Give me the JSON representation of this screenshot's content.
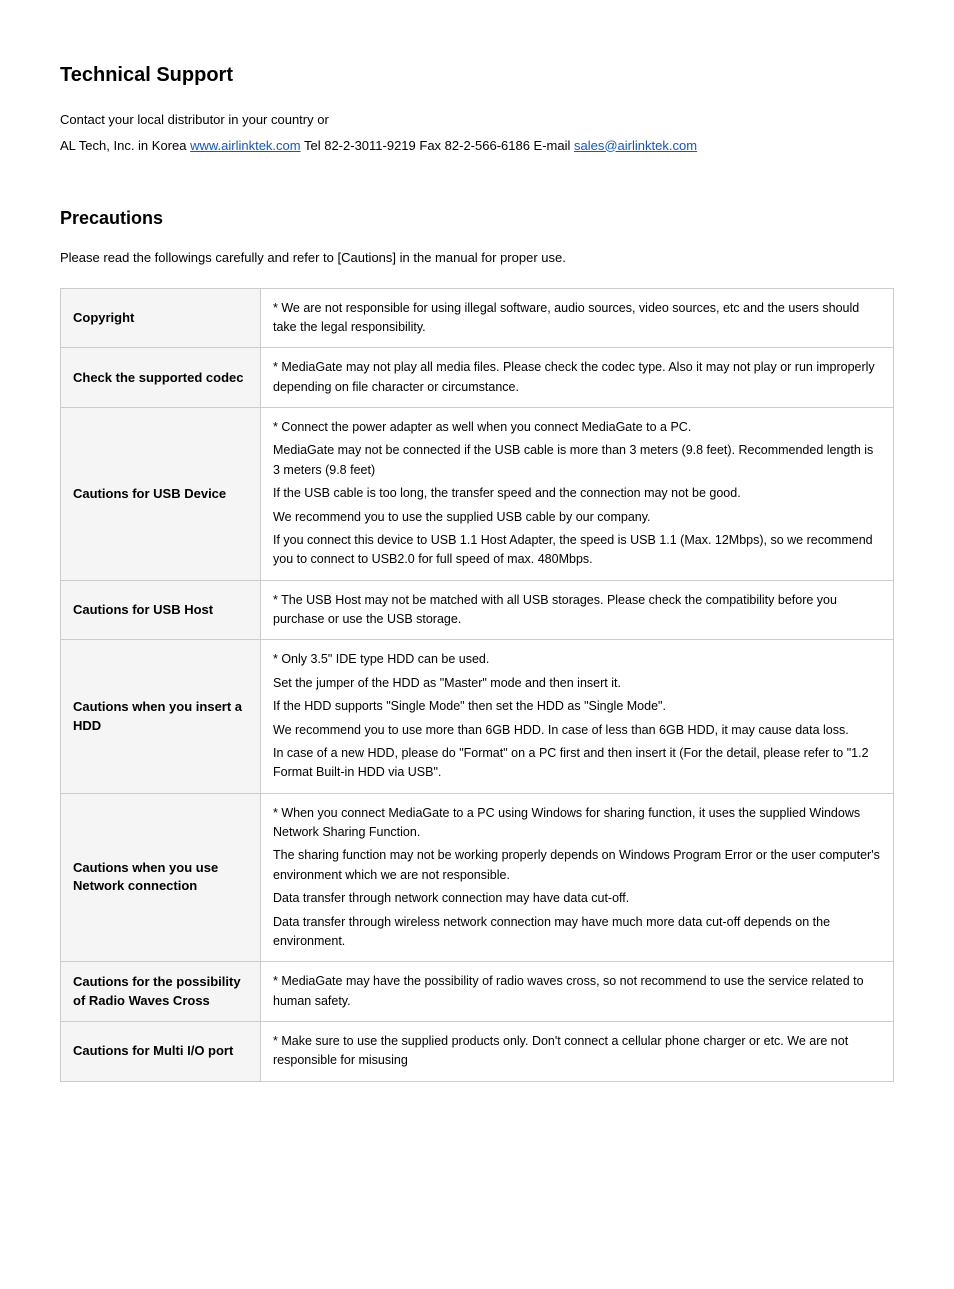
{
  "page": {
    "title": "Technical Support",
    "intro_lines": [
      "Contact your local distributor in your country or",
      {
        "prefix": "AL Tech, Inc. in Korea ",
        "website_text": "www.airlinktek.com",
        "website_href": "www.airlinktek.com",
        "middle": " Tel 82-2-3011-9219 Fax 82-2-566-6186 E-mail ",
        "email_text": "sales@airlinktek.com",
        "email_href": "mailto:sales@airlinktek.com"
      }
    ],
    "precautions_title": "Precautions",
    "precautions_intro": "Please read the followings carefully and refer to [Cautions] in the manual for proper use.",
    "table_rows": [
      {
        "label": "Copyright",
        "content": [
          "* We are not responsible for using illegal software, audio sources, video sources, etc and the users should take the legal responsibility."
        ]
      },
      {
        "label": "Check the supported codec",
        "content": [
          "* MediaGate may not play all media files. Please check the codec type. Also it may not play or run improperly depending on file character or circumstance."
        ]
      },
      {
        "label": "Cautions for USB Device",
        "content": [
          "* Connect the power adapter as well when you connect MediaGate to a PC.",
          "MediaGate may not be connected if the USB cable is more than 3 meters (9.8 feet). Recommended length is 3 meters (9.8 feet)",
          "If the USB cable is too long, the transfer speed and the connection may not be good.",
          "We recommend you to use the supplied USB cable by our company.",
          "If you connect this device to USB 1.1 Host Adapter, the speed is USB 1.1 (Max. 12Mbps), so we recommend you to connect to USB2.0 for full speed of max. 480Mbps."
        ]
      },
      {
        "label": "Cautions for USB Host",
        "content": [
          "* The USB Host may not be matched with all USB storages. Please check the compatibility before you purchase or use the USB storage."
        ]
      },
      {
        "label": "Cautions when you insert a HDD",
        "content": [
          "* Only 3.5\" IDE type HDD can be used.",
          "Set the jumper of the HDD as \"Master\" mode and then insert it.",
          "If the HDD supports \"Single Mode\" then set the HDD as \"Single Mode\".",
          "We recommend you to use more than 6GB HDD. In case of less than 6GB HDD, it may cause data loss.",
          "In case of a new HDD, please do \"Format\" on a PC first and then insert it (For the detail, please refer to \"1.2 Format Built-in HDD via USB\"."
        ]
      },
      {
        "label": "Cautions when you use Network connection",
        "content": [
          "* When you connect MediaGate to a PC using Windows for sharing function, it uses the supplied Windows Network Sharing Function.",
          "The sharing function may not be working properly depends on Windows Program Error or the user computer's environment which we are not responsible.",
          "Data transfer through network connection may have data cut-off.",
          "Data transfer through wireless network connection may have much more data cut-off depends on the environment."
        ]
      },
      {
        "label": "Cautions for the possibility of Radio Waves Cross",
        "content": [
          "* MediaGate may have the possibility of radio waves cross, so not recommend to use the service related to human safety."
        ]
      },
      {
        "label": "Cautions for Multi I/O port",
        "content": [
          "* Make sure to use the supplied products only. Don't connect a cellular phone charger or etc. We are not responsible for misusing"
        ]
      }
    ]
  }
}
